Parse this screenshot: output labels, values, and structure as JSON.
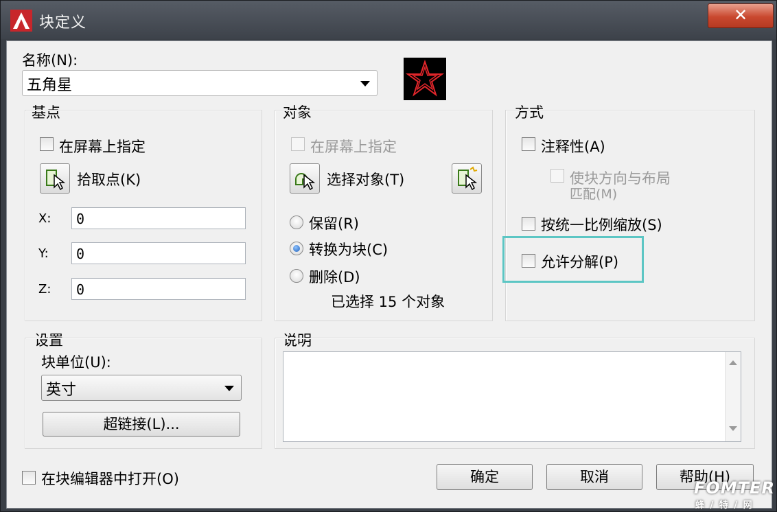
{
  "window": {
    "title": "块定义",
    "close_label": "✕"
  },
  "name_section": {
    "label": "名称(N):",
    "value": "五角星"
  },
  "base_point": {
    "title": "基点",
    "specify_on_screen": "在屏幕上指定",
    "pick_point": "拾取点(K)",
    "x_label": "X:",
    "x_value": "0",
    "y_label": "Y:",
    "y_value": "0",
    "z_label": "Z:",
    "z_value": "0"
  },
  "objects": {
    "title": "对象",
    "specify_on_screen": "在屏幕上指定",
    "select_objects": "选择对象(T)",
    "retain": "保留(R)",
    "convert_to_block": "转换为块(C)",
    "delete": "删除(D)",
    "selected_count": "已选择 15 个对象"
  },
  "behavior": {
    "title": "方式",
    "annotative": "注释性(A)",
    "match_orientation": "使块方向与布局",
    "match_orientation_2": "匹配(M)",
    "scale_uniformly": "按统一比例缩放(S)",
    "allow_exploding": "允许分解(P)"
  },
  "settings": {
    "title": "设置",
    "block_unit_label": "块单位(U):",
    "block_unit_value": "英寸",
    "hyperlink": "超链接(L)..."
  },
  "description": {
    "title": "说明"
  },
  "footer": {
    "open_in_editor": "在块编辑器中打开(O)",
    "ok": "确定",
    "cancel": "取消",
    "help": "帮助(H)"
  },
  "watermark": {
    "brand": "FOMTER",
    "sub": "蜂 / 特 / 网"
  },
  "colors": {
    "highlight": "#5cc6c4",
    "preview_bg": "#000000",
    "preview_star": "#e3262b"
  }
}
